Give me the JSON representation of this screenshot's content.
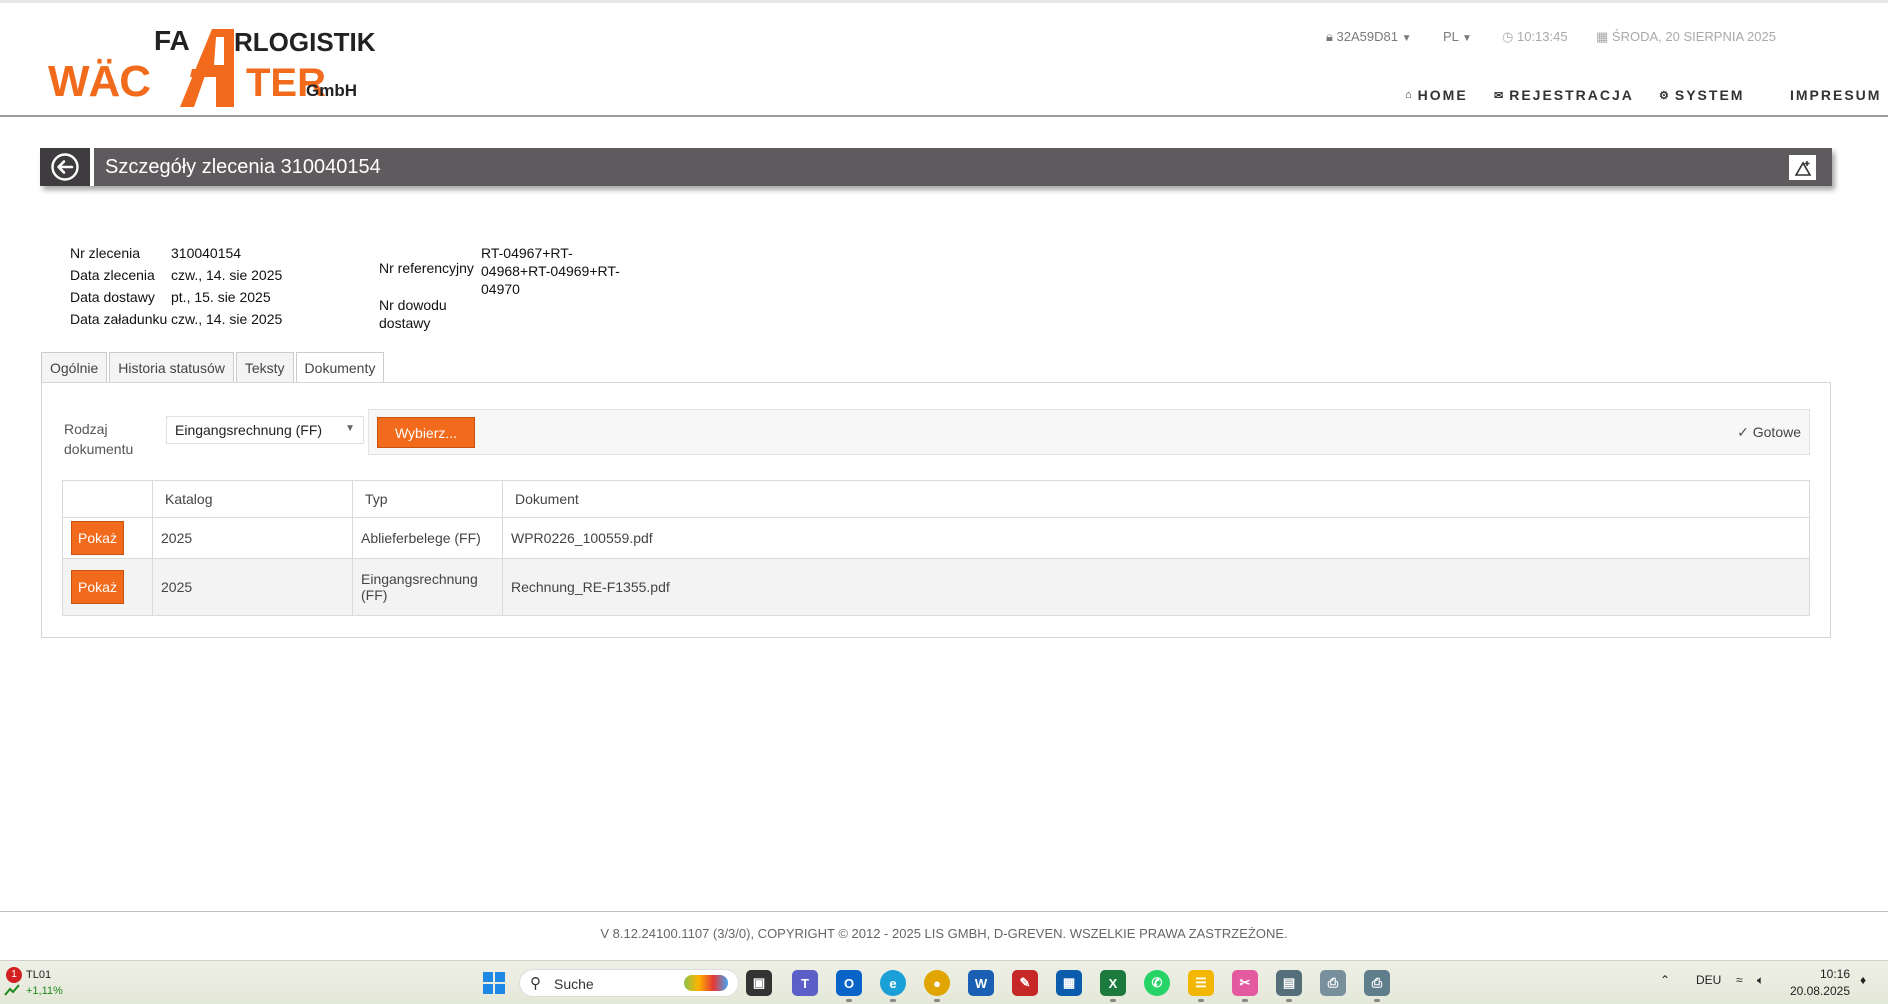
{
  "logo": {
    "line1_left": "FA",
    "line1_right": "RLOGISTIK",
    "line2_left": "WÄC",
    "line2_right": "TER",
    "line2_suffix": "GmbH"
  },
  "header": {
    "user": "32A59D81",
    "language": "PL",
    "time": "10:13:45",
    "date": "ŚRODA, 20 SIERPNIA 2025"
  },
  "nav": {
    "home": "HOME",
    "registration": "REJESTRACJA",
    "system": "SYSTEM",
    "impressum": "IMPRESUM"
  },
  "page": {
    "title": "Szczegóły zlecenia 310040154"
  },
  "details": {
    "rows": [
      {
        "label": "Nr zlecenia",
        "value": "310040154"
      },
      {
        "label": "Data zlecenia",
        "value": "czw., 14. sie 2025"
      },
      {
        "label": "Data dostawy",
        "value": "pt., 15. sie 2025"
      },
      {
        "label": "Data załadunku",
        "value": "czw., 14. sie 2025"
      }
    ],
    "reference_label": "Nr referencyjny",
    "reference_value": "RT-04967+RT-04968+RT-04969+RT-04970",
    "delivery_note_label": "Nr dowodu dostawy"
  },
  "tabs": [
    "Ogólnie",
    "Historia statusów",
    "Teksty",
    "Dokumenty"
  ],
  "active_tab": "Dokumenty",
  "documents": {
    "type_label": "Rodzaj dokumentu",
    "type_selected": "Eingangsrechnung (FF)",
    "choose_button": "Wybierz...",
    "ready_label": "Gotowe",
    "columns": [
      "",
      "Katalog",
      "Typ",
      "Dokument"
    ],
    "rows": [
      {
        "action": "Pokaż",
        "catalog": "2025",
        "type": "Ablieferbelege (FF)",
        "document": "WPR0226_100559.pdf"
      },
      {
        "action": "Pokaż",
        "catalog": "2025",
        "type": "Eingangsrechnung (FF)",
        "document": "Rechnung_RE-F1355.pdf"
      }
    ]
  },
  "footer": {
    "copyright": "V 8.12.24100.1107 (3/3/0), COPYRIGHT © 2012 - 2025 LIS GMBH, D-GREVEN. WSZELKIE PRAWA ZASTRZEŻONE."
  },
  "taskbar": {
    "ticker_name": "TL01",
    "ticker_change": "+1,11%",
    "ticker_badge": "1",
    "search_placeholder": "Suche",
    "language": "DEU",
    "time": "10:16",
    "date": "20.08.2025"
  },
  "colors": {
    "accent": "#f26a1b",
    "titlebar": "#5e5a5e"
  }
}
